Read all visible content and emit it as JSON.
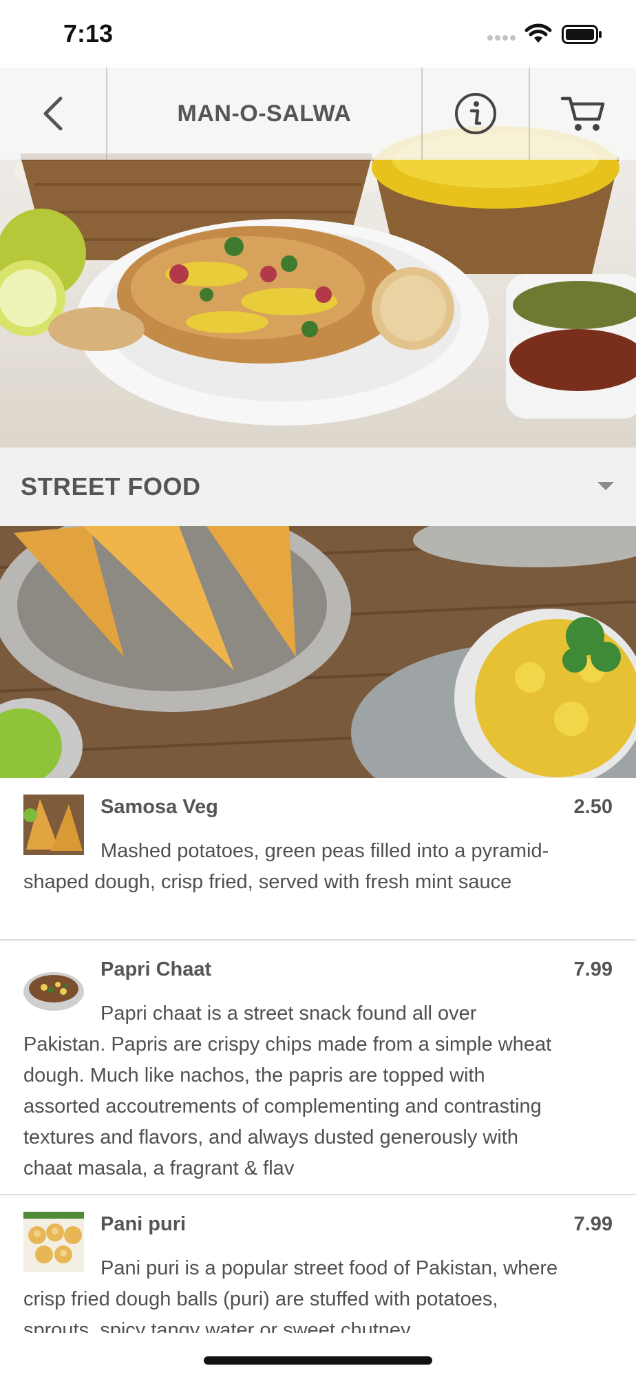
{
  "status_bar": {
    "time": "7:13"
  },
  "header": {
    "title": "MAN-O-SALWA",
    "back_icon": "chevron-left-icon",
    "info_icon": "info-icon",
    "cart_icon": "cart-icon"
  },
  "category": {
    "label": "STREET FOOD",
    "caret_icon": "caret-down-icon"
  },
  "items": [
    {
      "name": "Samosa Veg",
      "price": "2.50",
      "description": "Mashed potatoes, green peas filled into a pyramid-shaped dough, crisp fried, served with fresh mint sauce"
    },
    {
      "name": "Papri Chaat",
      "price": "7.99",
      "description": "Papri chaat is a street snack found all over Pakistan. Papris are crispy chips made from a simple wheat dough. Much like nachos, the papris are topped with assorted accoutrements of complementing and contrasting textures and flavors, and always dusted generously with chaat masala, a fragrant & flav"
    },
    {
      "name": "Pani puri",
      "price": "7.99",
      "description": "Pani puri is a popular street food of Pakistan, where crisp fried dough balls (puri) are stuffed with potatoes, sprouts, spicy tangy water or sweet chutney"
    }
  ],
  "colors": {
    "header_text": "#555555",
    "category_bg": "#f1f1f1",
    "divider": "#dcdcdc"
  }
}
